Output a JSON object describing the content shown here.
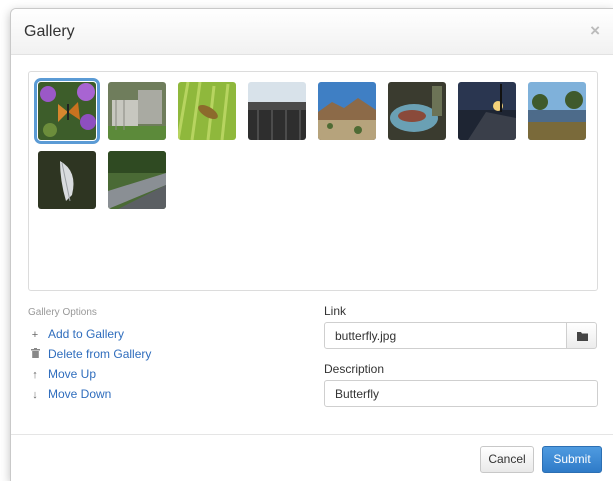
{
  "dialog": {
    "title": "Gallery",
    "close_glyph": "×"
  },
  "gallery": {
    "images": [
      {
        "name": "butterfly",
        "selected": true
      },
      {
        "name": "fence",
        "selected": false
      },
      {
        "name": "grasshopper",
        "selected": false
      },
      {
        "name": "bridge",
        "selected": false
      },
      {
        "name": "desert",
        "selected": false
      },
      {
        "name": "fish",
        "selected": false
      },
      {
        "name": "pier-sunset",
        "selected": false
      },
      {
        "name": "marsh",
        "selected": false
      },
      {
        "name": "feather",
        "selected": false
      },
      {
        "name": "boardwalk",
        "selected": false
      }
    ]
  },
  "options": {
    "heading": "Gallery Options",
    "items": [
      {
        "label": "Add to Gallery",
        "icon": "plus-icon",
        "glyph": "+"
      },
      {
        "label": "Delete from Gallery",
        "icon": "trash-icon",
        "glyph": "🗑"
      },
      {
        "label": "Move Up",
        "icon": "arrow-up-icon",
        "glyph": "↑"
      },
      {
        "label": "Move Down",
        "icon": "arrow-down-icon",
        "glyph": "↓"
      }
    ]
  },
  "form": {
    "link_label": "Link",
    "link_value": "butterfly.jpg",
    "description_label": "Description",
    "description_value": "Butterfly"
  },
  "footer": {
    "cancel_label": "Cancel",
    "submit_label": "Submit"
  },
  "colors": {
    "accent": "#2f7bc8",
    "link": "#2f6dbd",
    "selection": "#5b9bd5"
  }
}
